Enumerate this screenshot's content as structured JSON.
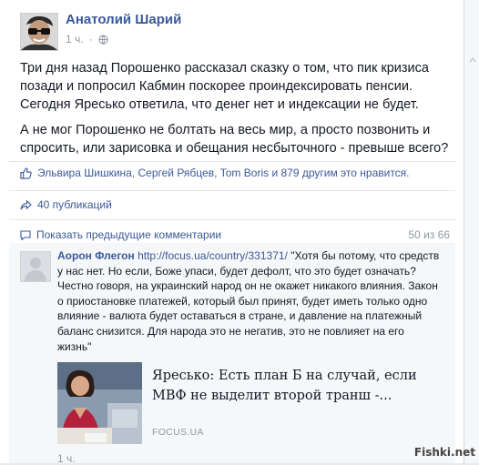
{
  "post": {
    "author": "Анатолий Шарий",
    "time": "1 ч.",
    "separator": "·",
    "paragraphs": [
      "Три дня назад Порошенко рассказал сказку о том, что пик кризиса позади и попросил Кабмин поскорее проиндексировать пенсии. Сегодня Яресько ответила, что денег нет и индексации не будет.",
      "А не мог Порошенко не болтать на весь мир, а просто позвонить и спросить, или зарисовка и обещания несбыточного - превыше всего?"
    ]
  },
  "likes": {
    "text": "Эльвира Шишкина, Сергей Рябцев, Tom Boris и 879 другим это нравится."
  },
  "shares": {
    "text": "40 публикаций"
  },
  "comments": {
    "show_previous": "Показать предыдущие комментарии",
    "count": "50 из 66",
    "items": [
      {
        "author": "Аорон Флегон",
        "link": "http://focus.ua/country/331371/",
        "text": " \"Хотя бы потому, что средств у нас нет. Но если, Боже упаси, будет дефолт, что это будет означать? Честно говоря, на украинский народ он не окажет никакого влияния. Закон о приостановке платежей, который был принят, будет иметь только одно влияние - валюта будет оставаться в стране, и давление на платежный баланс снизится. Для народа это не негатив, это не повлияет на его жизнь\"",
        "preview": {
          "title": "Яресько: Есть план Б на случай, если МВФ не выделит второй транш -...",
          "domain": "FOCUS.UA"
        },
        "time": "1 ч."
      }
    ]
  },
  "watermark": "Fishki.net",
  "colors": {
    "link": "#3b5998",
    "muted": "#9197a3",
    "text": "#141823"
  },
  "icons": [
    "globe-icon",
    "like-icon",
    "share-icon",
    "comment-icon"
  ]
}
